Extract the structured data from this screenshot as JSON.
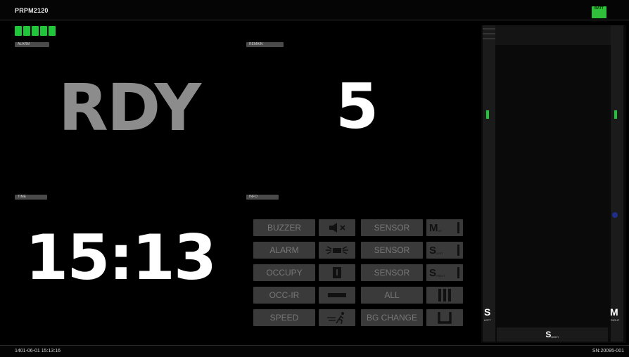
{
  "header": {
    "device_name": "PRPM2120",
    "battery_label": "BATT"
  },
  "panels": {
    "alarm_tag": "ALARM",
    "status_text": "RDY",
    "remain_tag": "REMAIN",
    "remain_value": "5",
    "time_tag": "TIME",
    "time_value": "15:13",
    "info_tag": "INFO"
  },
  "buttons": {
    "left": [
      "BUZZER",
      "ALARM",
      "OCCUPY",
      "OCC-IR",
      "SPEED"
    ],
    "sensor": [
      "SENSOR",
      "SENSOR",
      "SENSOR",
      "ALL",
      "BG CHANGE"
    ]
  },
  "sensor_icons": {
    "m_label": "M",
    "s_label": "S",
    "m_sub": "UP",
    "s1_sub": "LEFT",
    "s2_sub": "RIGHT"
  },
  "right_panel": {
    "left_indicator": "S",
    "right_indicator": "M",
    "left_sub": "LEFT",
    "right_sub": "RIGHT",
    "bottom_label": "S",
    "bottom_sub": "BODY"
  },
  "footer": {
    "datetime": "1401-06-01 15:13:16",
    "serial": "SN:20095-001"
  },
  "colors": {
    "signal": "#1fc63a",
    "battery": "#2fbf3a",
    "status_gray": "#8c8c8c"
  }
}
